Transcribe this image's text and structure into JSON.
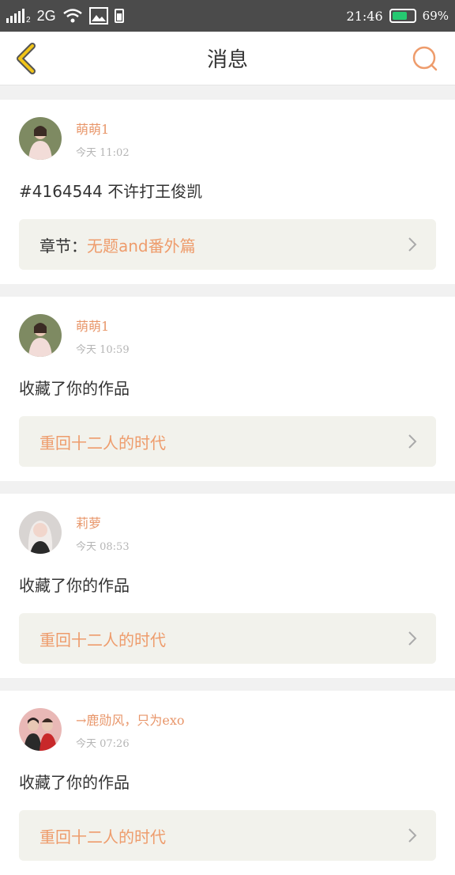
{
  "status_bar": {
    "carrier_small": "2",
    "network": "2G",
    "time": "21:46",
    "battery_percent": "69%",
    "battery_level": 0.69,
    "battery_color": "#25c971"
  },
  "header": {
    "title": "消息",
    "back_icon": "chevron-left-icon",
    "search_icon": "search-icon"
  },
  "messages": [
    {
      "user": "萌萌1",
      "time": "今天 11:02",
      "content": "#4164544 不许打王俊凯",
      "chapter_label": "章节：",
      "chapter_value": "无题and番外篇"
    },
    {
      "user": "萌萌1",
      "time": "今天 10:59",
      "content": "收藏了你的作品",
      "chapter_label": "",
      "chapter_value": "重回十二人的时代"
    },
    {
      "user": "莉萝",
      "time": "今天 08:53",
      "content": "收藏了你的作品",
      "chapter_label": "",
      "chapter_value": "重回十二人的时代"
    },
    {
      "user": "→鹿勋风，只为exo",
      "time": "今天 07:26",
      "content": "收藏了你的作品",
      "chapter_label": "",
      "chapter_value": "重回十二人的时代"
    }
  ],
  "colors": {
    "accent": "#ee9c6c",
    "back_yellow": "#f0c419",
    "back_gray": "#555555"
  }
}
